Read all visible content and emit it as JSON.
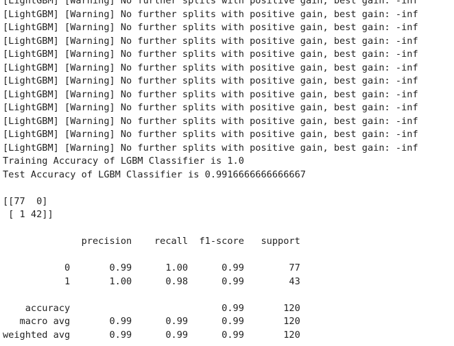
{
  "output": {
    "lines": [
      "[LightGBM] [Warning] No further splits with positive gain, best gain: -inf",
      "[LightGBM] [Warning] No further splits with positive gain, best gain: -inf",
      "[LightGBM] [Warning] No further splits with positive gain, best gain: -inf",
      "[LightGBM] [Warning] No further splits with positive gain, best gain: -inf",
      "[LightGBM] [Warning] No further splits with positive gain, best gain: -inf",
      "[LightGBM] [Warning] No further splits with positive gain, best gain: -inf",
      "[LightGBM] [Warning] No further splits with positive gain, best gain: -inf",
      "[LightGBM] [Warning] No further splits with positive gain, best gain: -inf",
      "[LightGBM] [Warning] No further splits with positive gain, best gain: -inf",
      "[LightGBM] [Warning] No further splits with positive gain, best gain: -inf",
      "[LightGBM] [Warning] No further splits with positive gain, best gain: -inf",
      "[LightGBM] [Warning] No further splits with positive gain, best gain: -inf",
      "Training Accuracy of LGBM Classifier is 1.0",
      "Test Accuracy of LGBM Classifier is 0.9916666666666667",
      "",
      "[[77  0]",
      " [ 1 42]]",
      "",
      "              precision    recall  f1-score   support",
      "",
      "           0       0.99      1.00      0.99        77",
      "           1       1.00      0.98      0.99        43",
      "",
      "    accuracy                           0.99       120",
      "   macro avg       0.99      0.99      0.99       120",
      "weighted avg       0.99      0.99      0.99       120"
    ]
  }
}
